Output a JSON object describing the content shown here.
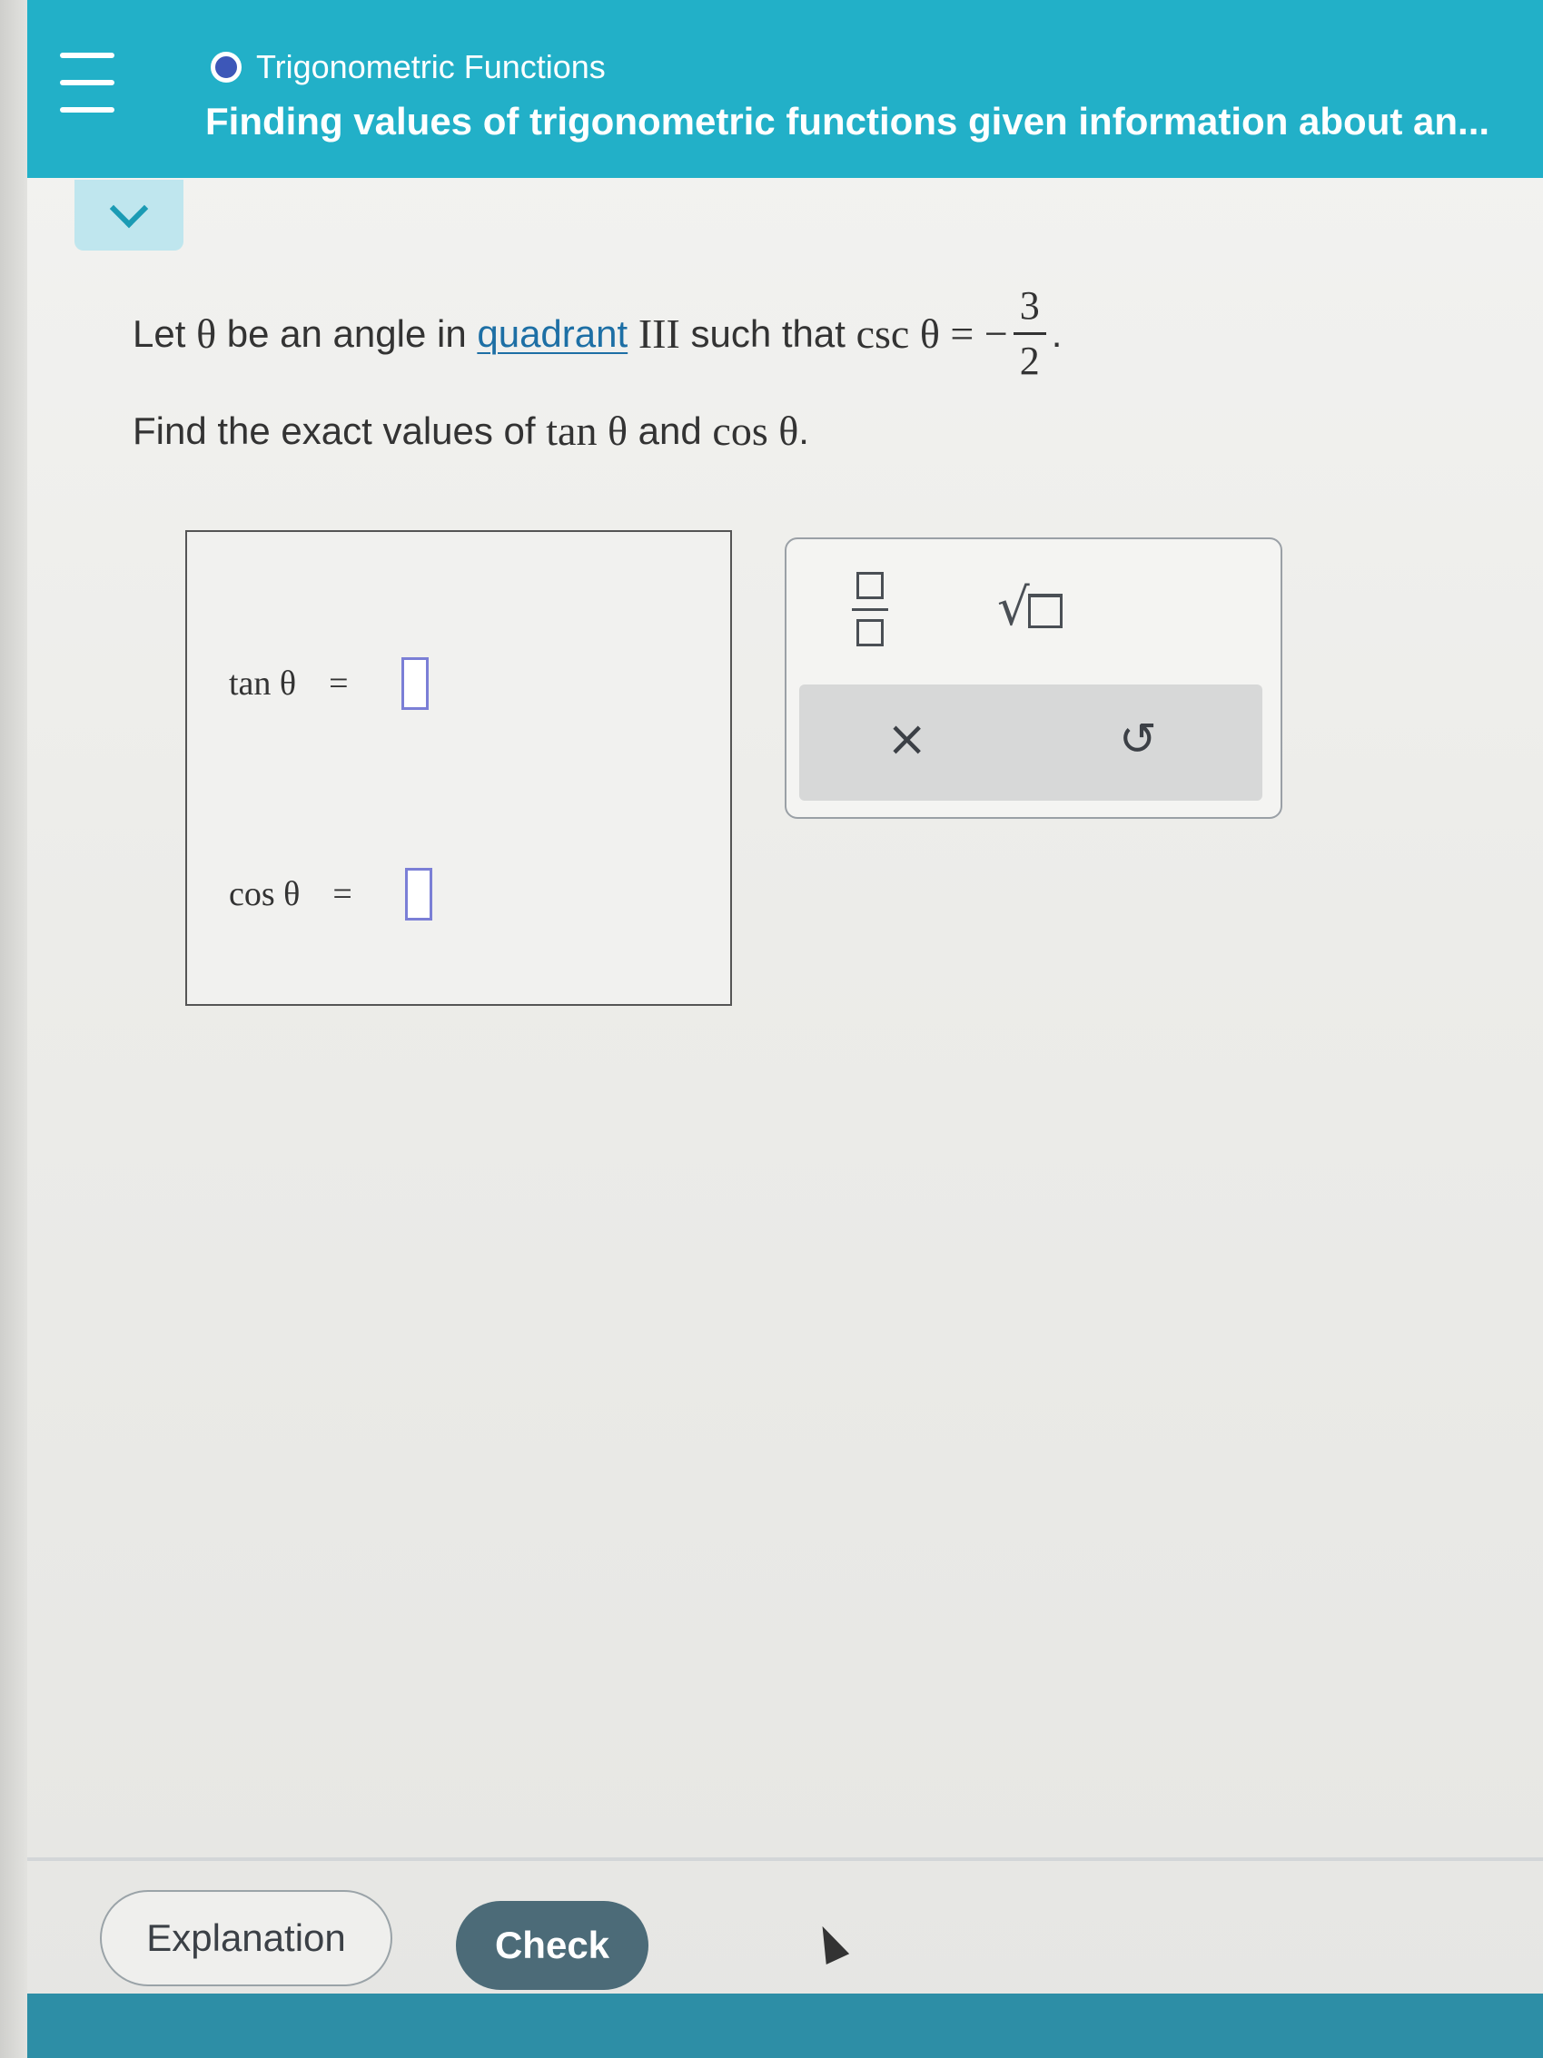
{
  "header": {
    "topic": "Trigonometric Functions",
    "lesson_title": "Finding values of trigonometric functions given information about an...",
    "accent_color": "#22b0c8",
    "icons": [
      "menu-icon",
      "topic-progress-icon",
      "chevron-down-icon"
    ]
  },
  "problem": {
    "line1_prefix": "Let",
    "theta": "θ",
    "line1_mid": "be an angle in",
    "link_text": "quadrant",
    "quadrant": "III",
    "such_that": "such that",
    "csc_expr": "csc θ = −",
    "frac_num": "3",
    "frac_den": "2",
    "period": ".",
    "line2_prefix": "Find the exact values of",
    "tan_expr": "tan θ",
    "and": "and",
    "cos_expr": "cos θ",
    "line2_end": "."
  },
  "answers": {
    "tan_label": "tan θ",
    "cos_label": "cos θ",
    "equals": "="
  },
  "keypad": {
    "keys": [
      "fraction-key",
      "sqrt-key"
    ],
    "clear_symbol": "×",
    "undo_symbol": "↺"
  },
  "footer": {
    "explanation_label": "Explanation",
    "check_label": "Check",
    "check_color": "#4c6b78"
  }
}
